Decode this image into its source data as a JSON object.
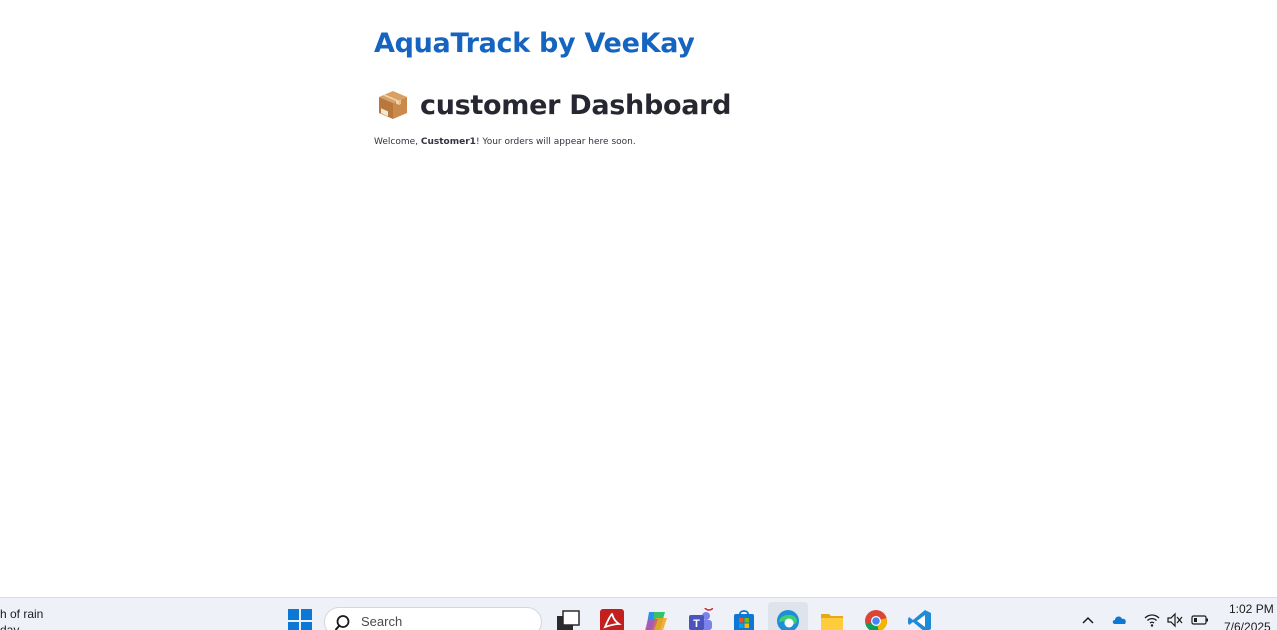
{
  "app": {
    "brand_title": "AquaTrack by VeeKay",
    "dashboard_emoji_icon": "package-icon",
    "dashboard_title": "customer Dashboard",
    "welcome": {
      "prefix": "Welcome, ",
      "username": "Customer1",
      "suffix": "! Your orders will appear here soon."
    },
    "colors": {
      "brand": "#1565c0",
      "title": "#262730",
      "text": "#31333f"
    }
  },
  "taskbar": {
    "weather_line1": "h of rain",
    "weather_line2": "day",
    "search_placeholder": "Search",
    "pinned_apps": [
      "windows-start-icon",
      "task-view-icon",
      "acrobat-icon",
      "copilot-icon",
      "teams-icon",
      "microsoft-store-icon",
      "edge-icon",
      "file-explorer-icon",
      "chrome-icon",
      "vscode-icon"
    ],
    "tray_icons": [
      "chevron-up-icon",
      "onedrive-icon",
      "wifi-icon",
      "volume-muted-icon",
      "battery-icon"
    ],
    "clock_time": "1:02 PM",
    "clock_date": "7/6/2025"
  }
}
